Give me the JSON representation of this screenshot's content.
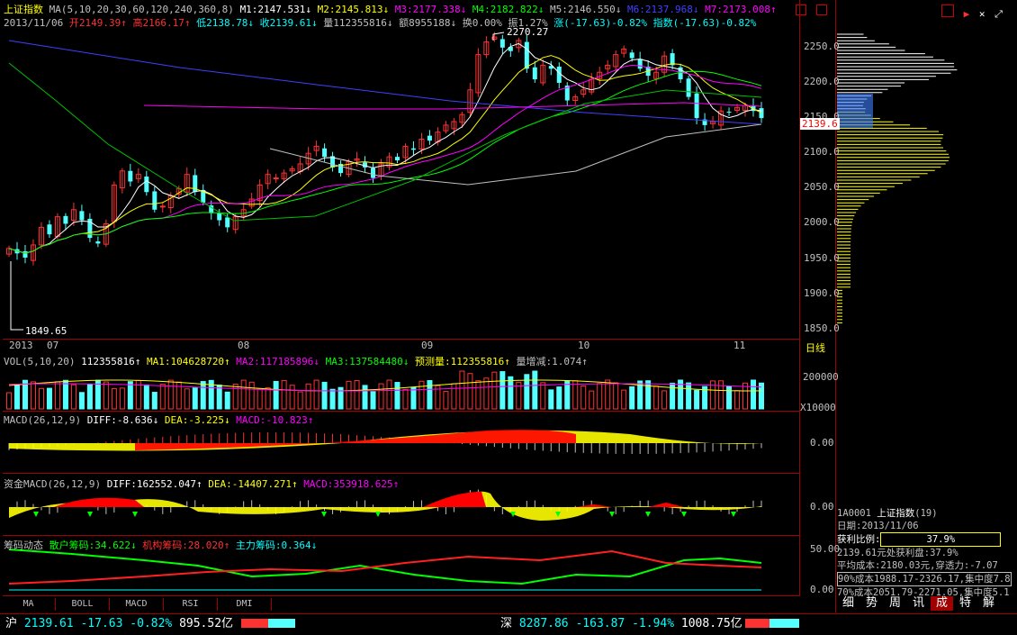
{
  "header": {
    "title": "上证指数",
    "ma_label": "MA(5,10,20,30,60,120,240,360,8)",
    "ma_values": [
      {
        "t": "M1:2147.531↓",
        "c": "#ffffff"
      },
      {
        "t": "M2:2145.813↓",
        "c": "#ffff00"
      },
      {
        "t": "M3:2177.338↓",
        "c": "#ff00ff"
      },
      {
        "t": "M4:2182.822↓",
        "c": "#00ff00"
      },
      {
        "t": "M5:2146.550↓",
        "c": "#c0c0c0"
      },
      {
        "t": "M6:2137.968↓",
        "c": "#4040ff"
      },
      {
        "t": "M7:2173.008↑",
        "c": "#ff00ff"
      }
    ],
    "date": "2013/11/06",
    "info": [
      {
        "t": "开2149.39↑",
        "c": "#ff3232"
      },
      {
        "t": "高2166.17↑",
        "c": "#ff3232"
      },
      {
        "t": "低2138.78↓",
        "c": "#00ffff"
      },
      {
        "t": "收2139.61↓",
        "c": "#00ffff"
      },
      {
        "t": "量112355816↓",
        "c": "#c0c0c0"
      },
      {
        "t": "额8955188↓",
        "c": "#c0c0c0"
      },
      {
        "t": "换0.00%",
        "c": "#c0c0c0"
      },
      {
        "t": "振1.27%",
        "c": "#c0c0c0"
      },
      {
        "t": "涨(-17.63)-0.82%",
        "c": "#00ffff"
      },
      {
        "t": "指数(-17.63)-0.82%",
        "c": "#00ffff"
      }
    ]
  },
  "annotations": {
    "high": "2270.27",
    "low": "1849.65"
  },
  "price_axis": {
    "ticks": [
      "2250.0",
      "2200.0",
      "2150.0",
      "2100.0",
      "2050.0",
      "2000.0",
      "1950.0",
      "1900.0",
      "1850.0"
    ],
    "current": "2139.6"
  },
  "date_axis": {
    "labels": [
      "2013",
      "07",
      "08",
      "09",
      "10",
      "11"
    ],
    "period": "日线"
  },
  "vol_panel": {
    "label": "VOL(5,10,20)",
    "items": [
      {
        "t": "112355816↑",
        "c": "#ffffff"
      },
      {
        "t": "MA1:104628720↑",
        "c": "#ffff00"
      },
      {
        "t": "MA2:117185896↓",
        "c": "#ff00ff"
      },
      {
        "t": "MA3:137584480↓",
        "c": "#00ff00"
      },
      {
        "t": "预测量:112355816↑",
        "c": "#ffff00"
      },
      {
        "t": "量增减:1.074↑",
        "c": "#c0c0c0"
      }
    ],
    "tick": "200000",
    "unit": "X10000"
  },
  "macd_panel": {
    "label": "MACD(26,12,9)",
    "items": [
      {
        "t": "DIFF:-8.636↓",
        "c": "#ffffff"
      },
      {
        "t": "DEA:-3.225↓",
        "c": "#ffff00"
      },
      {
        "t": "MACD:-10.823↑",
        "c": "#ff00ff"
      }
    ],
    "tick": "0.00"
  },
  "fund_panel": {
    "label": "资金MACD(26,12,9)",
    "items": [
      {
        "t": "DIFF:162552.047↑",
        "c": "#ffffff"
      },
      {
        "t": "DEA:-14407.271↑",
        "c": "#ffff00"
      },
      {
        "t": "MACD:353918.625↑",
        "c": "#ff00ff"
      }
    ],
    "tick": "0.00"
  },
  "chip_panel": {
    "label": "筹码动态",
    "items": [
      {
        "t": "散户筹码:34.622↓",
        "c": "#00ff00"
      },
      {
        "t": "机构筹码:28.020↑",
        "c": "#ff3232"
      },
      {
        "t": "主力筹码:0.364↓",
        "c": "#00ffff"
      }
    ],
    "ticks": [
      "50.00",
      "0.00"
    ]
  },
  "bottom_tabs": [
    "MA",
    "BOLL",
    "MACD",
    "RSI",
    "DMI"
  ],
  "side_info": {
    "code": "1A0001",
    "name": "上证指数",
    "count": "(19)",
    "date_label": "日期:2013/11/06",
    "profit_label": "获利比例:",
    "profit_value": "37.9%",
    "line1": "2139.61元处获利盘:37.9%",
    "line2": "平均成本:2180.03元,穿透力:-7.07",
    "line3": "90%成本1988.17-2326.17,集中度7.8",
    "line4": "70%成本2051.79-2271.05,集中度5.1"
  },
  "side_tabs": [
    "细",
    "势",
    "周",
    "讯",
    "成",
    "特",
    "解"
  ],
  "status_bar": {
    "sh_label": "沪",
    "sh_price": "2139.61",
    "sh_change": "-17.63",
    "sh_pct": "-0.82%",
    "sh_amount": "895.52亿",
    "sz_label": "深",
    "sz_price": "8287.86",
    "sz_change": "-163.87",
    "sz_pct": "-1.94%",
    "sz_amount": "1008.75亿"
  },
  "colors": {
    "up": "#ff3232",
    "down": "#54ffff",
    "border": "#a00000",
    "yellow": "#ffff00",
    "cost_white": "#ffffff"
  },
  "icons": [
    "chart-icon",
    "flag-icon",
    "tools-icon",
    "close-icon",
    "arrow-icon"
  ],
  "chart_data": {
    "type": "candlestick",
    "ylim": [
      1849.65,
      2270.27
    ],
    "x_month_labels": [
      "07",
      "08",
      "09",
      "10",
      "11"
    ],
    "close_path": [
      1955,
      1948,
      1942,
      1960,
      1985,
      1975,
      2000,
      1990,
      2010,
      1995,
      1970,
      1962,
      1990,
      2045,
      2065,
      2050,
      2060,
      2035,
      2010,
      2015,
      2030,
      2040,
      2060,
      2035,
      2020,
      2005,
      1995,
      1985,
      2000,
      2010,
      2025,
      2045,
      2060,
      2055,
      2062,
      2068,
      2075,
      2090,
      2100,
      2085,
      2070,
      2062,
      2078,
      2082,
      2070,
      2055,
      2075,
      2085,
      2080,
      2100,
      2095,
      2110,
      2108,
      2120,
      2130,
      2135,
      2145,
      2180,
      2230,
      2248,
      2255,
      2240,
      2235,
      2250,
      2210,
      2195,
      2215,
      2210,
      2190,
      2165,
      2170,
      2180,
      2195,
      2205,
      2215,
      2230,
      2238,
      2225,
      2210,
      2200,
      2205,
      2228,
      2215,
      2195,
      2170,
      2140,
      2130,
      2135,
      2150,
      2148,
      2155,
      2158,
      2150,
      2140
    ],
    "volume_profile_note": "cost distribution"
  }
}
